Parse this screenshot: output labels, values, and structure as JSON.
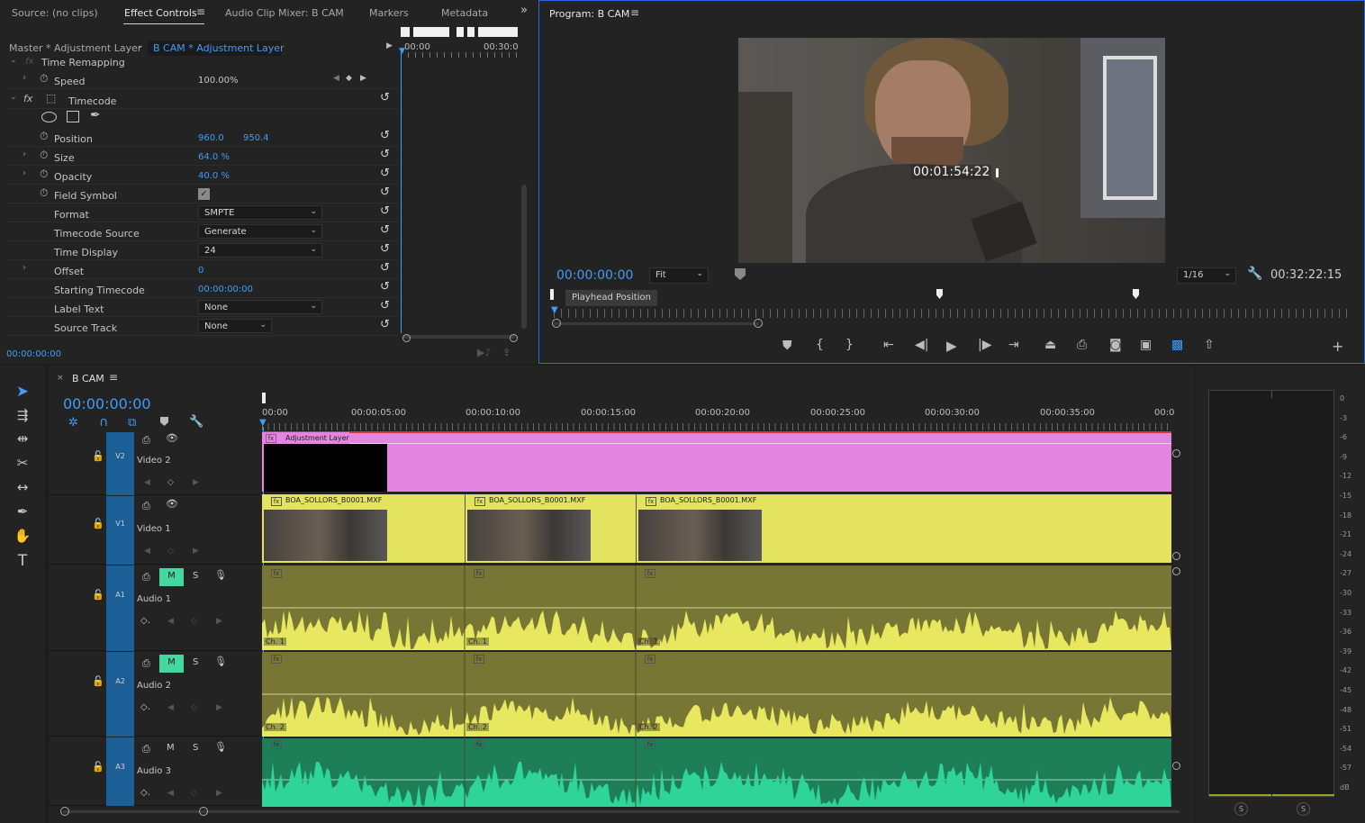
{
  "source_panel": {
    "tabs": [
      {
        "label": "Source: (no clips)"
      },
      {
        "label": "Effect Controls"
      },
      {
        "label": "Audio Clip Mixer: B CAM"
      },
      {
        "label": "Markers"
      },
      {
        "label": "Metadata"
      }
    ],
    "master_label": "Master * Adjustment Layer",
    "clip_label": "B CAM * Adjustment Layer",
    "mini_ruler": [
      "00:00",
      "00:30:0"
    ],
    "section_time_remap": "Time Remapping",
    "speed": {
      "label": "Speed",
      "value": "100.00%"
    },
    "effect_name": "Timecode",
    "rows": [
      {
        "label": "Position",
        "v1": "960.0",
        "v2": "950.4"
      },
      {
        "label": "Size",
        "v1": "64.0 %"
      },
      {
        "label": "Opacity",
        "v1": "40.0 %"
      },
      {
        "label": "Field Symbol"
      },
      {
        "label": "Format",
        "dd": "SMPTE"
      },
      {
        "label": "Timecode Source",
        "dd": "Generate"
      },
      {
        "label": "Time Display",
        "dd": "24"
      },
      {
        "label": "Offset",
        "v1": "0"
      },
      {
        "label": "Starting Timecode",
        "v1": "00:00:00:00"
      },
      {
        "label": "Label Text",
        "dd": "None"
      },
      {
        "label": "Source Track",
        "dd": "None"
      }
    ],
    "bottom_timecode": "00:00:00:00"
  },
  "program": {
    "title": "Program: B CAM",
    "overlay_timecode": "00:01:54:22",
    "current_timecode": "00:00:00:00",
    "fit": "Fit",
    "resolution": "1/16",
    "duration": "00:32:22:15",
    "tooltip": "Playhead Position"
  },
  "timeline": {
    "sequence_name": "B CAM",
    "timecode": "00:00:00:00",
    "ruler": [
      "00:00",
      "00:00:05:00",
      "00:00:10:00",
      "00:00:15:00",
      "00:00:20:00",
      "00:00:25:00",
      "00:00:30:00",
      "00:00:35:00",
      "00:0"
    ],
    "tracks": {
      "v2": {
        "target": "V2",
        "name": "Video 2"
      },
      "v1": {
        "target": "V1",
        "name": "Video 1"
      },
      "a1": {
        "target": "A1",
        "name": "Audio 1"
      },
      "a2": {
        "target": "A2",
        "name": "Audio 2"
      },
      "a3": {
        "target": "A3",
        "name": "Audio 3"
      }
    },
    "mute": "M",
    "solo": "S",
    "adjustment_clip": "Adjustment Layer",
    "video_clips": [
      "BOA_SOLLORS_B0001.MXF",
      "BOA_SOLLORS_B0001.MXF",
      "BOA_SOLLORS_B0001.MXF"
    ],
    "ch1": "Ch. 1",
    "ch2": "Ch. 2",
    "colors": {
      "adjustment": "#e386e0",
      "video": "#e4e360",
      "audio": "#787634",
      "audio3": "#1e7e58",
      "wave": "#e8e860",
      "wave3": "#2fd49a"
    }
  },
  "meters": {
    "scale": [
      "0",
      "-3",
      "-6",
      "-9",
      "-12",
      "-15",
      "-18",
      "-21",
      "-24",
      "-27",
      "-30",
      "-33",
      "-36",
      "-39",
      "-42",
      "-45",
      "-48",
      "-51",
      "-54",
      "-57",
      "dB"
    ],
    "solo_buttons": [
      "S",
      "S"
    ]
  }
}
